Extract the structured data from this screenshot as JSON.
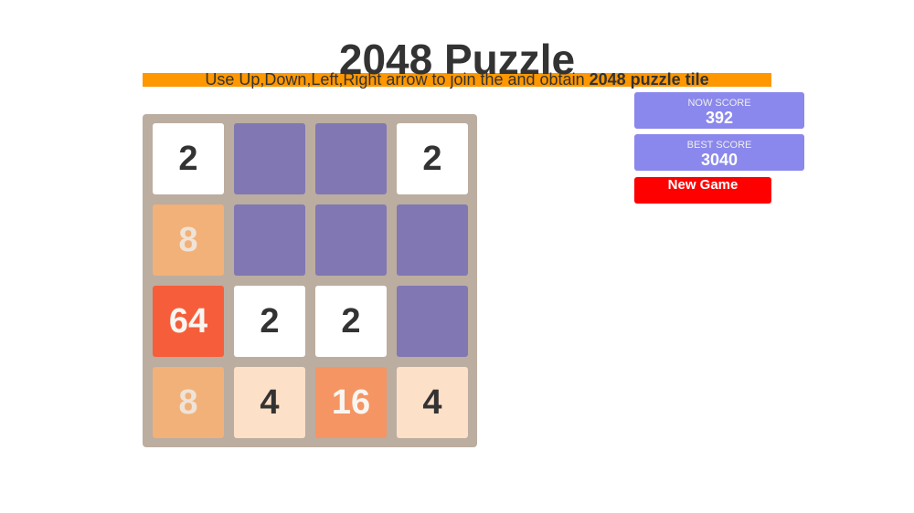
{
  "header": {
    "title": "2048 Puzzle",
    "instructions_prefix": "Use Up,Down,Left,Right arrow to join the and obtain ",
    "instructions_bold": "2048 puzzle tile"
  },
  "scores": {
    "now_label": "NOW SCORE",
    "now_value": "392",
    "best_label": "BEST SCORE",
    "best_value": "3040"
  },
  "controls": {
    "new_game_label": "New Game"
  },
  "board": {
    "rows": [
      [
        2,
        null,
        null,
        2
      ],
      [
        8,
        null,
        null,
        null
      ],
      [
        64,
        2,
        2,
        null
      ],
      [
        8,
        4,
        16,
        4
      ]
    ]
  },
  "colors": {
    "empty": "#8077b3",
    "board_bg": "#bbada0",
    "instruction_bar": "#ff9700",
    "score_box": "#8a88ec",
    "new_game": "#ff0000",
    "tiles": {
      "2": {
        "bg": "#ffffff",
        "fg": "#333333"
      },
      "4": {
        "bg": "#fde0c8",
        "fg": "#333333"
      },
      "8": {
        "bg": "#f2b179",
        "fg": "#efe3d7"
      },
      "16": {
        "bg": "#f59563",
        "fg": "#f9f6f2"
      },
      "64": {
        "bg": "#f65e3b",
        "fg": "#f9f6f2"
      }
    }
  }
}
